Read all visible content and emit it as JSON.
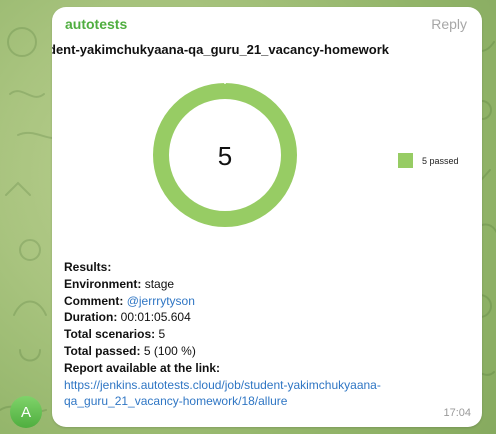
{
  "chat": {
    "avatar_initial": "A",
    "avatar_color": "#4fae3f",
    "wallpaper_color": "#a9c47f"
  },
  "message": {
    "sender": "autotests",
    "reply_label": "Reply",
    "time": "17:04",
    "chart_card": {
      "title": "dent-yakimchukyaana-qa_guru_21_vacancy-homework",
      "center_value": "5",
      "legend_label": "5 passed",
      "ring_color": "#97cc64"
    },
    "lines": {
      "results_label": "Results:",
      "environment_label": "Environment:",
      "environment_value": "stage",
      "comment_label": "Comment:",
      "comment_value": "@jerrrytyson",
      "duration_label": "Duration:",
      "duration_value": "00:01:05.604",
      "total_scenarios_label": "Total scenarios:",
      "total_scenarios_value": "5",
      "total_passed_label": "Total passed:",
      "total_passed_value": "5 (100 %)",
      "report_label": "Report available at the link:",
      "report_url_line1": "https://jenkins.autotests.cloud/job/student-yakimchukyaana-",
      "report_url_line2": "qa_guru_21_vacancy-homework/18/allure"
    }
  },
  "chart_data": {
    "type": "pie",
    "categories": [
      "passed"
    ],
    "values": [
      5
    ],
    "title": "dent-yakimchukyaana-qa_guru_21_vacancy-homework",
    "center_label": "5",
    "legend": [
      "5 passed"
    ],
    "legend_position": "right",
    "colors": [
      "#97cc64"
    ]
  }
}
